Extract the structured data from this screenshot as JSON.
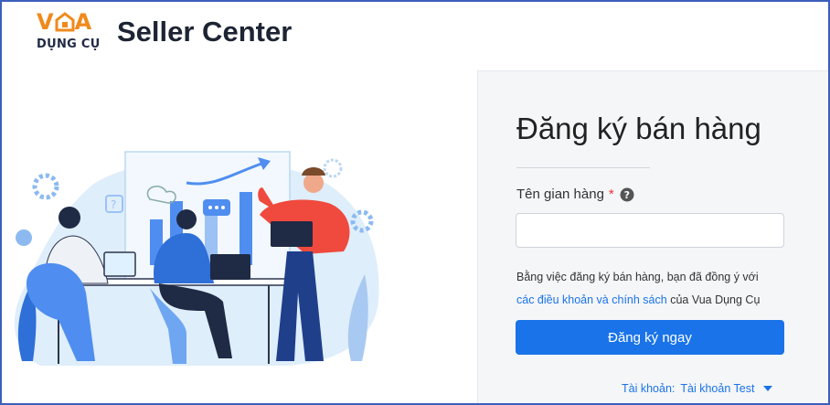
{
  "brand": {
    "logo_top": "V A",
    "logo_bottom": "DỤNG CỤ",
    "app_title": "Seller Center",
    "accent_color": "#f08a1c"
  },
  "illustration": {
    "icon_names": [
      "gear-icon",
      "chart-arrow-icon",
      "question-icon",
      "chat-bubble-icon",
      "laptop-icon"
    ]
  },
  "form": {
    "title": "Đăng ký bán hàng",
    "store_name_label": "Tên gian hàng",
    "required_mark": "*",
    "store_name_value": "",
    "store_name_placeholder": "",
    "agreement_prefix": "Bằng việc đăng ký bán hàng, bạn đã đồng ý với",
    "terms_link": "các điều khoản và chính sách",
    "agreement_suffix": "của Vua Dụng Cụ",
    "submit_label": "Đăng ký ngay",
    "primary_color": "#1a73e8"
  },
  "account": {
    "label": "Tài khoản:",
    "value": "Tài khoản Test"
  }
}
